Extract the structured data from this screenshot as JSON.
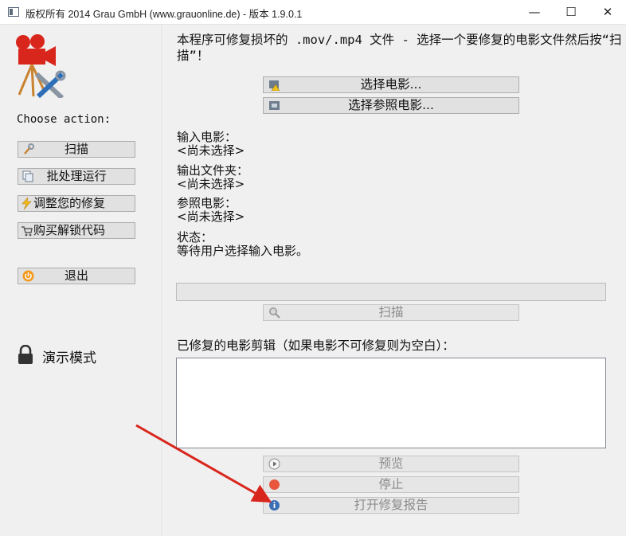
{
  "window": {
    "title": "版权所有 2014 Grau GmbH (www.grauonline.de) - 版本 1.9.0.1",
    "minimize_symbol": "—",
    "maximize_symbol": "☐",
    "close_symbol": "✕"
  },
  "sidebar": {
    "choose_label": "Choose action:",
    "buttons": [
      {
        "label": "扫描",
        "icon": "wrench-icon"
      },
      {
        "label": "批处理运行",
        "icon": "batch-icon"
      },
      {
        "label": "调整您的修复",
        "icon": "lightning-icon"
      },
      {
        "label": "购买解锁代码",
        "icon": "cart-icon"
      },
      {
        "label": "退出",
        "icon": "power-icon"
      }
    ],
    "demo_mode": "演示模式"
  },
  "main": {
    "instruction": "本程序可修复损坏的 .mov/.mp4 文件 - 选择一个要修复的电影文件然后按“扫描”！",
    "select_movie": "选择电影...",
    "select_reference": "选择参照电影...",
    "input_movie_label": "输入电影：",
    "input_movie_value": "<尚未选择>",
    "output_folder_label": "输出文件夹：",
    "output_folder_value": "<尚未选择>",
    "reference_movie_label": "参照电影：",
    "reference_movie_value": "<尚未选择>",
    "status_label": "状态：",
    "status_value": "等待用户选择输入电影。",
    "progress": 0,
    "scan_button": "扫描",
    "repaired_label": "已修复的电影剪辑（如果电影不可修复则为空白）：",
    "preview_button": "预览",
    "stop_button": "停止",
    "open_report_button": "打开修复报告"
  },
  "colors": {
    "accent_red": "#d9261c",
    "progress_fill": "#06b025"
  }
}
